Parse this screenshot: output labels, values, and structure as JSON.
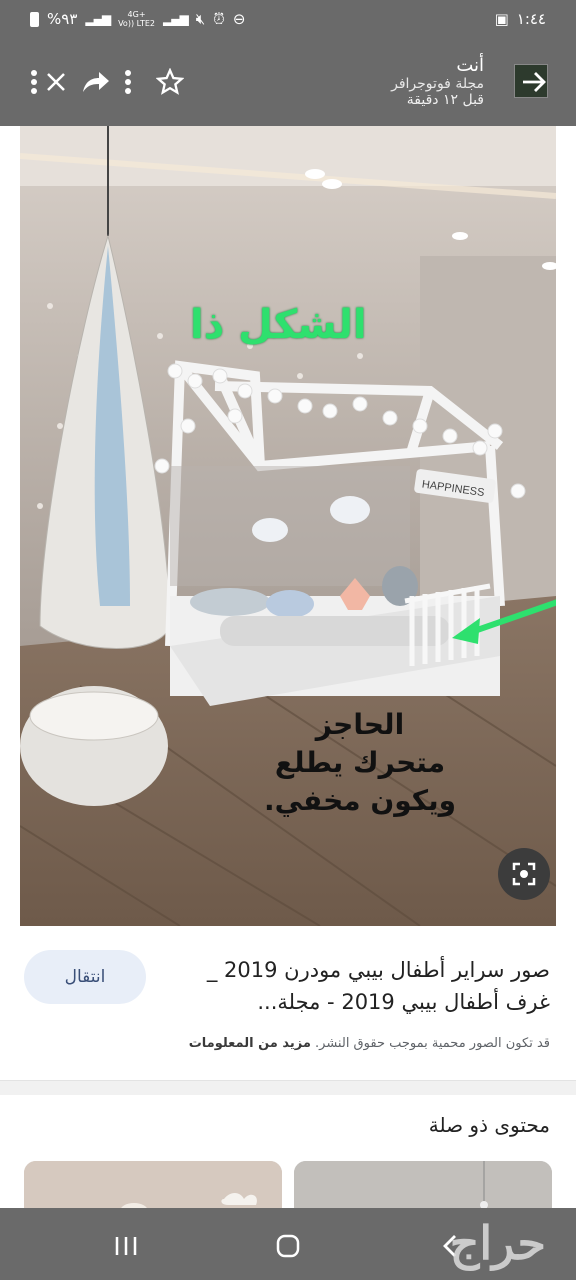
{
  "status_bar": {
    "battery": "%٩٣",
    "network": "4G+",
    "volte": "Vo)) LTE2",
    "time": "١:٤٤"
  },
  "toolbar": {
    "title": "أنت",
    "subtitle": "مجلة فوتوجرافر",
    "time_ago": "قبل ١٢ دقيقة"
  },
  "image_overlay": {
    "green_text": "الشكل ذا",
    "black_line1": "الحاجز",
    "black_line2": "متحرك يطلع",
    "black_line3": "ويكون مخفي.",
    "sign_text": "HAPPINESS"
  },
  "info": {
    "visit_label": "انتقال",
    "title": "صور سراير أطفال بيبي مودرن 2019 _ غرف أطفال بيبي 2019 - مجلة...",
    "copyright_text": "قد تكون الصور محمية بموجب حقوق النشر.",
    "more_info": "مزيد من المعلومات"
  },
  "related": {
    "title": "محتوى ذو صلة"
  },
  "watermark": "حراج",
  "icons": [
    "more-vert-icon",
    "close-icon",
    "share-icon",
    "more-options-icon",
    "star-icon",
    "back-arrow-icon",
    "lens-icon",
    "recents-icon",
    "home-icon",
    "back-icon"
  ],
  "colors": {
    "bars": "#6a6a6a",
    "accent_green": "#2ee06e",
    "visit_bg": "#e8eef8"
  }
}
